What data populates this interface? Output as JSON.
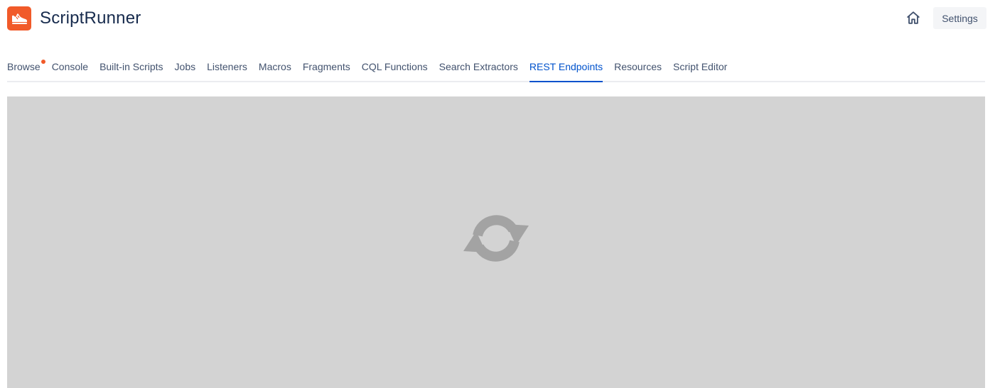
{
  "app": {
    "title": "ScriptRunner",
    "logo_icon": "sneaker-icon",
    "brand_color": "#f15a29"
  },
  "header": {
    "home_icon": "home-icon",
    "settings_label": "Settings"
  },
  "tabs": [
    {
      "label": "Browse",
      "active": false,
      "notification_dot": true
    },
    {
      "label": "Console",
      "active": false
    },
    {
      "label": "Built-in Scripts",
      "active": false
    },
    {
      "label": "Jobs",
      "active": false
    },
    {
      "label": "Listeners",
      "active": false
    },
    {
      "label": "Macros",
      "active": false
    },
    {
      "label": "Fragments",
      "active": false
    },
    {
      "label": "CQL Functions",
      "active": false
    },
    {
      "label": "Search Extractors",
      "active": false
    },
    {
      "label": "REST Endpoints",
      "active": true
    },
    {
      "label": "Resources",
      "active": false
    },
    {
      "label": "Script Editor",
      "active": false
    }
  ],
  "content": {
    "state": "loading",
    "spinner_icon": "refresh-icon",
    "overlay_color": "#d3d3d3",
    "active_color": "#0052cc"
  }
}
